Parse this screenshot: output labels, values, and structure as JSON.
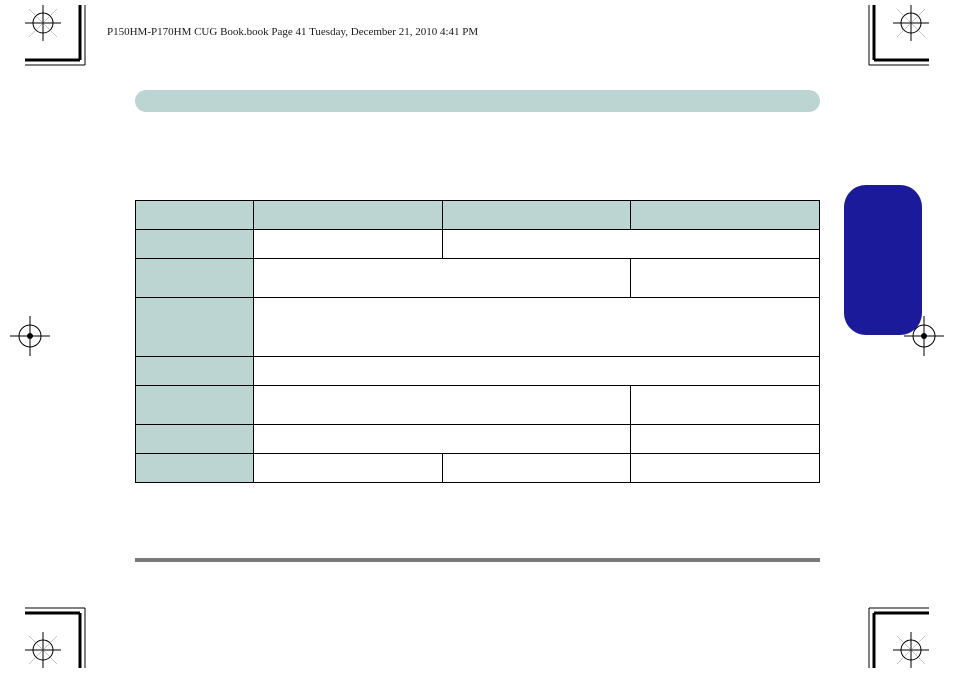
{
  "header": {
    "text": "P150HM-P170HM CUG Book.book  Page 41  Tuesday, December 21, 2010  4:41 PM"
  },
  "pill": {
    "text": ""
  },
  "table": {
    "rows": [
      {
        "type": "header",
        "cells": [
          "",
          "",
          "",
          ""
        ]
      },
      {
        "type": "row2",
        "cells": [
          "",
          "",
          ""
        ]
      },
      {
        "type": "row2tall",
        "cells": [
          "",
          "",
          ""
        ]
      },
      {
        "type": "fulltall",
        "cells": [
          "",
          ""
        ]
      },
      {
        "type": "full",
        "cells": [
          "",
          ""
        ]
      },
      {
        "type": "row2med",
        "cells": [
          "",
          "",
          ""
        ]
      },
      {
        "type": "row2",
        "cells": [
          "",
          "",
          ""
        ]
      },
      {
        "type": "row4",
        "cells": [
          "",
          "",
          "",
          ""
        ]
      }
    ]
  }
}
